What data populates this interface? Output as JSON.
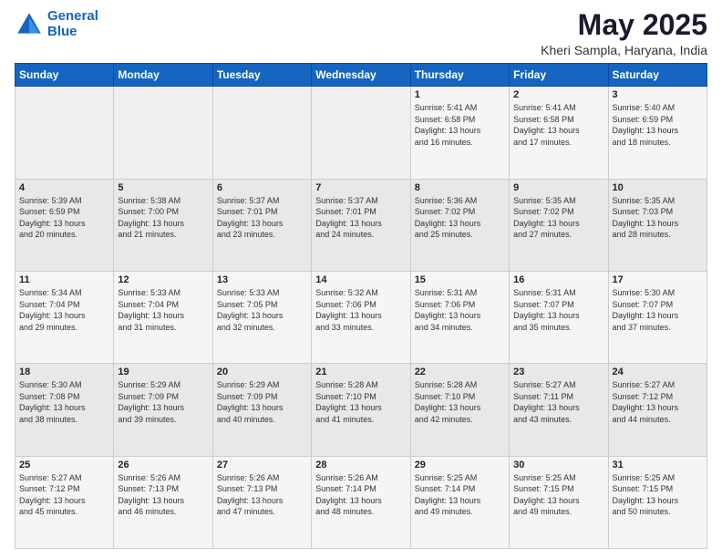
{
  "logo": {
    "text_general": "General",
    "text_blue": "Blue"
  },
  "header": {
    "month": "May 2025",
    "location": "Kheri Sampla, Haryana, India"
  },
  "weekdays": [
    "Sunday",
    "Monday",
    "Tuesday",
    "Wednesday",
    "Thursday",
    "Friday",
    "Saturday"
  ],
  "weeks": [
    [
      {
        "day": "",
        "info": ""
      },
      {
        "day": "",
        "info": ""
      },
      {
        "day": "",
        "info": ""
      },
      {
        "day": "",
        "info": ""
      },
      {
        "day": "1",
        "info": "Sunrise: 5:41 AM\nSunset: 6:58 PM\nDaylight: 13 hours\nand 16 minutes."
      },
      {
        "day": "2",
        "info": "Sunrise: 5:41 AM\nSunset: 6:58 PM\nDaylight: 13 hours\nand 17 minutes."
      },
      {
        "day": "3",
        "info": "Sunrise: 5:40 AM\nSunset: 6:59 PM\nDaylight: 13 hours\nand 18 minutes."
      }
    ],
    [
      {
        "day": "4",
        "info": "Sunrise: 5:39 AM\nSunset: 6:59 PM\nDaylight: 13 hours\nand 20 minutes."
      },
      {
        "day": "5",
        "info": "Sunrise: 5:38 AM\nSunset: 7:00 PM\nDaylight: 13 hours\nand 21 minutes."
      },
      {
        "day": "6",
        "info": "Sunrise: 5:37 AM\nSunset: 7:01 PM\nDaylight: 13 hours\nand 23 minutes."
      },
      {
        "day": "7",
        "info": "Sunrise: 5:37 AM\nSunset: 7:01 PM\nDaylight: 13 hours\nand 24 minutes."
      },
      {
        "day": "8",
        "info": "Sunrise: 5:36 AM\nSunset: 7:02 PM\nDaylight: 13 hours\nand 25 minutes."
      },
      {
        "day": "9",
        "info": "Sunrise: 5:35 AM\nSunset: 7:02 PM\nDaylight: 13 hours\nand 27 minutes."
      },
      {
        "day": "10",
        "info": "Sunrise: 5:35 AM\nSunset: 7:03 PM\nDaylight: 13 hours\nand 28 minutes."
      }
    ],
    [
      {
        "day": "11",
        "info": "Sunrise: 5:34 AM\nSunset: 7:04 PM\nDaylight: 13 hours\nand 29 minutes."
      },
      {
        "day": "12",
        "info": "Sunrise: 5:33 AM\nSunset: 7:04 PM\nDaylight: 13 hours\nand 31 minutes."
      },
      {
        "day": "13",
        "info": "Sunrise: 5:33 AM\nSunset: 7:05 PM\nDaylight: 13 hours\nand 32 minutes."
      },
      {
        "day": "14",
        "info": "Sunrise: 5:32 AM\nSunset: 7:06 PM\nDaylight: 13 hours\nand 33 minutes."
      },
      {
        "day": "15",
        "info": "Sunrise: 5:31 AM\nSunset: 7:06 PM\nDaylight: 13 hours\nand 34 minutes."
      },
      {
        "day": "16",
        "info": "Sunrise: 5:31 AM\nSunset: 7:07 PM\nDaylight: 13 hours\nand 35 minutes."
      },
      {
        "day": "17",
        "info": "Sunrise: 5:30 AM\nSunset: 7:07 PM\nDaylight: 13 hours\nand 37 minutes."
      }
    ],
    [
      {
        "day": "18",
        "info": "Sunrise: 5:30 AM\nSunset: 7:08 PM\nDaylight: 13 hours\nand 38 minutes."
      },
      {
        "day": "19",
        "info": "Sunrise: 5:29 AM\nSunset: 7:09 PM\nDaylight: 13 hours\nand 39 minutes."
      },
      {
        "day": "20",
        "info": "Sunrise: 5:29 AM\nSunset: 7:09 PM\nDaylight: 13 hours\nand 40 minutes."
      },
      {
        "day": "21",
        "info": "Sunrise: 5:28 AM\nSunset: 7:10 PM\nDaylight: 13 hours\nand 41 minutes."
      },
      {
        "day": "22",
        "info": "Sunrise: 5:28 AM\nSunset: 7:10 PM\nDaylight: 13 hours\nand 42 minutes."
      },
      {
        "day": "23",
        "info": "Sunrise: 5:27 AM\nSunset: 7:11 PM\nDaylight: 13 hours\nand 43 minutes."
      },
      {
        "day": "24",
        "info": "Sunrise: 5:27 AM\nSunset: 7:12 PM\nDaylight: 13 hours\nand 44 minutes."
      }
    ],
    [
      {
        "day": "25",
        "info": "Sunrise: 5:27 AM\nSunset: 7:12 PM\nDaylight: 13 hours\nand 45 minutes."
      },
      {
        "day": "26",
        "info": "Sunrise: 5:26 AM\nSunset: 7:13 PM\nDaylight: 13 hours\nand 46 minutes."
      },
      {
        "day": "27",
        "info": "Sunrise: 5:26 AM\nSunset: 7:13 PM\nDaylight: 13 hours\nand 47 minutes."
      },
      {
        "day": "28",
        "info": "Sunrise: 5:26 AM\nSunset: 7:14 PM\nDaylight: 13 hours\nand 48 minutes."
      },
      {
        "day": "29",
        "info": "Sunrise: 5:25 AM\nSunset: 7:14 PM\nDaylight: 13 hours\nand 49 minutes."
      },
      {
        "day": "30",
        "info": "Sunrise: 5:25 AM\nSunset: 7:15 PM\nDaylight: 13 hours\nand 49 minutes."
      },
      {
        "day": "31",
        "info": "Sunrise: 5:25 AM\nSunset: 7:15 PM\nDaylight: 13 hours\nand 50 minutes."
      }
    ]
  ]
}
